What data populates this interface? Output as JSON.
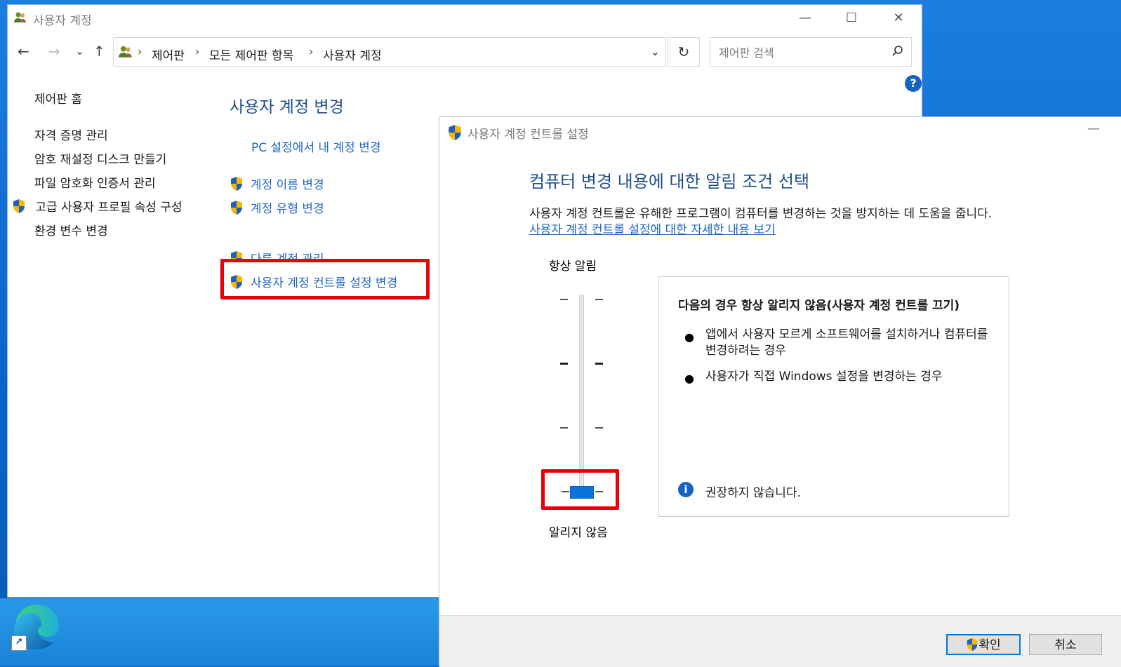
{
  "window": {
    "title": "사용자 계정",
    "controls": {
      "minimize": "—",
      "maximize": "☐",
      "close": "✕"
    }
  },
  "navigation": {
    "back": "←",
    "forward": "→",
    "recent": "⌄",
    "up": "↑",
    "breadcrumb": [
      "제어판",
      "모든 제어판 항목",
      "사용자 계정"
    ],
    "separator": "›",
    "dropdown": "⌄",
    "refresh": "↻",
    "search_placeholder": "제어판 검색",
    "help": "?"
  },
  "sidebar": {
    "items": [
      {
        "label": "제어판 홈"
      },
      {
        "label": "자격 증명 관리"
      },
      {
        "label": "암호 재설정 디스크 만들기"
      },
      {
        "label": "파일 암호화 인증서 관리"
      },
      {
        "label": "고급 사용자 프로필 속성 구성",
        "shield": true
      },
      {
        "label": "환경 변수 변경"
      }
    ]
  },
  "main": {
    "title": "사용자 계정 변경",
    "links": [
      {
        "label": "PC 설정에서 내 계정 변경"
      },
      {
        "label": "계정 이름 변경",
        "shield": true
      },
      {
        "label": "계정 유형 변경",
        "shield": true
      },
      {
        "label": "다른 계정 관리",
        "shield": true
      },
      {
        "label": "사용자 계정 컨트롤 설정 변경",
        "shield": true,
        "highlighted": true
      }
    ]
  },
  "uac_dialog": {
    "title": "사용자 계정 컨트롤 설정",
    "minimize": "—",
    "heading": "컴퓨터 변경 내용에 대한 알림 조건 선택",
    "description": "사용자 계정 컨트롤은 유해한 프로그램이 컴퓨터를 변경하는 것을 방지하는 데 도움을 줍니다.",
    "more_info_link": "사용자 계정 컨트롤 설정에 대한 자세한 내용 보기",
    "slider": {
      "top_label": "항상 알림",
      "bottom_label": "알리지 않음",
      "levels": 4,
      "selected_level": 1
    },
    "panel": {
      "title": "다음의 경우 항상 알리지 않음(사용자 계정 컨트롤 끄기)",
      "bullets": [
        "앱에서 사용자 모르게 소프트웨어를 설치하거나 컴퓨터를 변경하려는 경우",
        "사용자가 직접 Windows 설정을 변경하는 경우"
      ],
      "bullet_mark": "●",
      "info_icon": "i",
      "note": "권장하지 않습니다."
    },
    "buttons": {
      "ok": "확인",
      "cancel": "취소"
    }
  },
  "colors": {
    "highlight": "#e8000a",
    "link": "#1e66c0",
    "heading": "#1e4e8c",
    "slider_thumb": "#0b73d9"
  }
}
